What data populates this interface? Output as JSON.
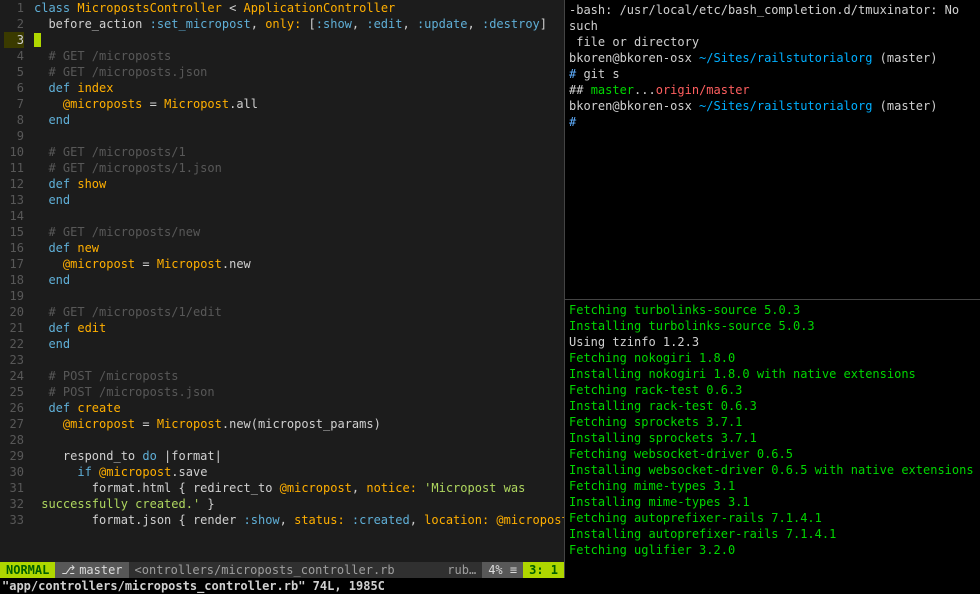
{
  "editor": {
    "lines": [
      [
        {
          "t": "class ",
          "c": "kw"
        },
        {
          "t": "MicropostsController",
          "c": "cls"
        },
        {
          "t": " < ",
          "c": "punct"
        },
        {
          "t": "ApplicationController",
          "c": "cls"
        }
      ],
      [
        {
          "t": "  before_action ",
          "c": "punct"
        },
        {
          "t": ":set_micropost",
          "c": "sym"
        },
        {
          "t": ", ",
          "c": "punct"
        },
        {
          "t": "only:",
          "c": "id2"
        },
        {
          "t": " [",
          "c": "punct"
        },
        {
          "t": ":show",
          "c": "sym"
        },
        {
          "t": ", ",
          "c": "punct"
        },
        {
          "t": ":edit",
          "c": "sym"
        },
        {
          "t": ", ",
          "c": "punct"
        },
        {
          "t": ":update",
          "c": "sym"
        },
        {
          "t": ", ",
          "c": "punct"
        },
        {
          "t": ":destroy",
          "c": "sym"
        },
        {
          "t": "]",
          "c": "punct"
        }
      ],
      [
        {
          "t": "",
          "c": "punct",
          "cursor": true
        }
      ],
      [
        {
          "t": "  # GET /microposts",
          "c": "cmt"
        }
      ],
      [
        {
          "t": "  # GET /microposts.json",
          "c": "cmt"
        }
      ],
      [
        {
          "t": "  ",
          "c": ""
        },
        {
          "t": "def ",
          "c": "kw"
        },
        {
          "t": "index",
          "c": "cls"
        }
      ],
      [
        {
          "t": "    ",
          "c": ""
        },
        {
          "t": "@microposts",
          "c": "id2"
        },
        {
          "t": " = ",
          "c": "punct"
        },
        {
          "t": "Micropost",
          "c": "cls"
        },
        {
          "t": ".all",
          "c": "punct"
        }
      ],
      [
        {
          "t": "  ",
          "c": ""
        },
        {
          "t": "end",
          "c": "kw"
        }
      ],
      [
        {
          "t": "",
          "c": ""
        }
      ],
      [
        {
          "t": "  # GET /microposts/1",
          "c": "cmt"
        }
      ],
      [
        {
          "t": "  # GET /microposts/1.json",
          "c": "cmt"
        }
      ],
      [
        {
          "t": "  ",
          "c": ""
        },
        {
          "t": "def ",
          "c": "kw"
        },
        {
          "t": "show",
          "c": "cls"
        }
      ],
      [
        {
          "t": "  ",
          "c": ""
        },
        {
          "t": "end",
          "c": "kw"
        }
      ],
      [
        {
          "t": "",
          "c": ""
        }
      ],
      [
        {
          "t": "  # GET /microposts/new",
          "c": "cmt"
        }
      ],
      [
        {
          "t": "  ",
          "c": ""
        },
        {
          "t": "def ",
          "c": "kw"
        },
        {
          "t": "new",
          "c": "cls"
        }
      ],
      [
        {
          "t": "    ",
          "c": ""
        },
        {
          "t": "@micropost",
          "c": "id2"
        },
        {
          "t": " = ",
          "c": "punct"
        },
        {
          "t": "Micropost",
          "c": "cls"
        },
        {
          "t": ".new",
          "c": "punct"
        }
      ],
      [
        {
          "t": "  ",
          "c": ""
        },
        {
          "t": "end",
          "c": "kw"
        }
      ],
      [
        {
          "t": "",
          "c": ""
        }
      ],
      [
        {
          "t": "  # GET /microposts/1/edit",
          "c": "cmt"
        }
      ],
      [
        {
          "t": "  ",
          "c": ""
        },
        {
          "t": "def ",
          "c": "kw"
        },
        {
          "t": "edit",
          "c": "cls"
        }
      ],
      [
        {
          "t": "  ",
          "c": ""
        },
        {
          "t": "end",
          "c": "kw"
        }
      ],
      [
        {
          "t": "",
          "c": ""
        }
      ],
      [
        {
          "t": "  # POST /microposts",
          "c": "cmt"
        }
      ],
      [
        {
          "t": "  # POST /microposts.json",
          "c": "cmt"
        }
      ],
      [
        {
          "t": "  ",
          "c": ""
        },
        {
          "t": "def ",
          "c": "kw"
        },
        {
          "t": "create",
          "c": "cls"
        }
      ],
      [
        {
          "t": "    ",
          "c": ""
        },
        {
          "t": "@micropost",
          "c": "id2"
        },
        {
          "t": " = ",
          "c": "punct"
        },
        {
          "t": "Micropost",
          "c": "cls"
        },
        {
          "t": ".new(micropost_params)",
          "c": "punct"
        }
      ],
      [
        {
          "t": "",
          "c": ""
        }
      ],
      [
        {
          "t": "    respond_to ",
          "c": "punct"
        },
        {
          "t": "do",
          "c": "kw"
        },
        {
          "t": " |format|",
          "c": "punct"
        }
      ],
      [
        {
          "t": "      ",
          "c": ""
        },
        {
          "t": "if ",
          "c": "kw"
        },
        {
          "t": "@micropost",
          "c": "id2"
        },
        {
          "t": ".save",
          "c": "punct"
        }
      ],
      [
        {
          "t": "        format.html { redirect_to ",
          "c": "punct"
        },
        {
          "t": "@micropost",
          "c": "id2"
        },
        {
          "t": ", ",
          "c": "punct"
        },
        {
          "t": "notice:",
          "c": "id2"
        },
        {
          "t": " ",
          "c": "punct"
        },
        {
          "t": "'Micropost was",
          "c": "str"
        }
      ],
      [
        {
          "t": " successfully created.'",
          "c": "str"
        },
        {
          "t": " }",
          "c": "punct"
        }
      ],
      [
        {
          "t": "        format.json { render ",
          "c": "punct"
        },
        {
          "t": ":show",
          "c": "sym"
        },
        {
          "t": ", ",
          "c": "punct"
        },
        {
          "t": "status:",
          "c": "id2"
        },
        {
          "t": " ",
          "c": "punct"
        },
        {
          "t": ":created",
          "c": "sym"
        },
        {
          "t": ", ",
          "c": "punct"
        },
        {
          "t": "location:",
          "c": "id2"
        },
        {
          "t": " ",
          "c": "punct"
        },
        {
          "t": "@micropost",
          "c": "id2"
        },
        {
          "t": " }",
          "c": "punct"
        }
      ]
    ],
    "cursor_line_idx": 2
  },
  "statusbar": {
    "mode": " NORMAL ",
    "branch_icon": "⎇",
    "branch": "master",
    "filename": "<ontrollers/microposts_controller.rb",
    "filetype": "rub…",
    "percent": "4% ≡",
    "position": "3:  1"
  },
  "msgline": "\"app/controllers/microposts_controller.rb\" 74L, 1985C",
  "term_top": [
    {
      "segs": [
        {
          "t": "-bash: /usr/local/etc/bash_completion.d/tmuxinator: No such",
          "c": "t-white"
        }
      ]
    },
    {
      "segs": [
        {
          "t": " file or directory",
          "c": "t-white"
        }
      ]
    },
    {
      "segs": [
        {
          "t": "",
          "c": ""
        }
      ]
    },
    {
      "segs": [
        {
          "t": "bkoren@bkoren-osx ",
          "c": "t-white"
        },
        {
          "t": "~/Sites/railstutorialorg",
          "c": "t-cyan"
        },
        {
          "t": " (master)",
          "c": "t-white"
        }
      ]
    },
    {
      "segs": [
        {
          "t": "# ",
          "c": "t-blue"
        },
        {
          "t": "git s",
          "c": "t-white"
        }
      ]
    },
    {
      "segs": [
        {
          "t": "## ",
          "c": "t-white"
        },
        {
          "t": "master",
          "c": "t-green"
        },
        {
          "t": "...",
          "c": "t-white"
        },
        {
          "t": "origin/master",
          "c": "t-red"
        }
      ]
    },
    {
      "segs": [
        {
          "t": "",
          "c": ""
        }
      ]
    },
    {
      "segs": [
        {
          "t": "bkoren@bkoren-osx ",
          "c": "t-white"
        },
        {
          "t": "~/Sites/railstutorialorg",
          "c": "t-cyan"
        },
        {
          "t": " (master)",
          "c": "t-white"
        }
      ]
    },
    {
      "segs": [
        {
          "t": "#",
          "c": "t-blue"
        }
      ]
    }
  ],
  "term_bot": [
    {
      "t": "Fetching turbolinks-source 5.0.3",
      "c": "t-green"
    },
    {
      "t": "Installing turbolinks-source 5.0.3",
      "c": "t-green"
    },
    {
      "t": "Using tzinfo 1.2.3",
      "c": "t-white"
    },
    {
      "t": "Fetching nokogiri 1.8.0",
      "c": "t-green"
    },
    {
      "t": "Installing nokogiri 1.8.0 with native extensions",
      "c": "t-green"
    },
    {
      "t": "Fetching rack-test 0.6.3",
      "c": "t-green"
    },
    {
      "t": "Installing rack-test 0.6.3",
      "c": "t-green"
    },
    {
      "t": "Fetching sprockets 3.7.1",
      "c": "t-green"
    },
    {
      "t": "Installing sprockets 3.7.1",
      "c": "t-green"
    },
    {
      "t": "Fetching websocket-driver 0.6.5",
      "c": "t-green"
    },
    {
      "t": "Installing websocket-driver 0.6.5 with native extensions",
      "c": "t-green"
    },
    {
      "t": "Fetching mime-types 3.1",
      "c": "t-green"
    },
    {
      "t": "Installing mime-types 3.1",
      "c": "t-green"
    },
    {
      "t": "Fetching autoprefixer-rails 7.1.4.1",
      "c": "t-green"
    },
    {
      "t": "Installing autoprefixer-rails 7.1.4.1",
      "c": "t-green"
    },
    {
      "t": "Fetching uglifier 3.2.0",
      "c": "t-green"
    }
  ]
}
